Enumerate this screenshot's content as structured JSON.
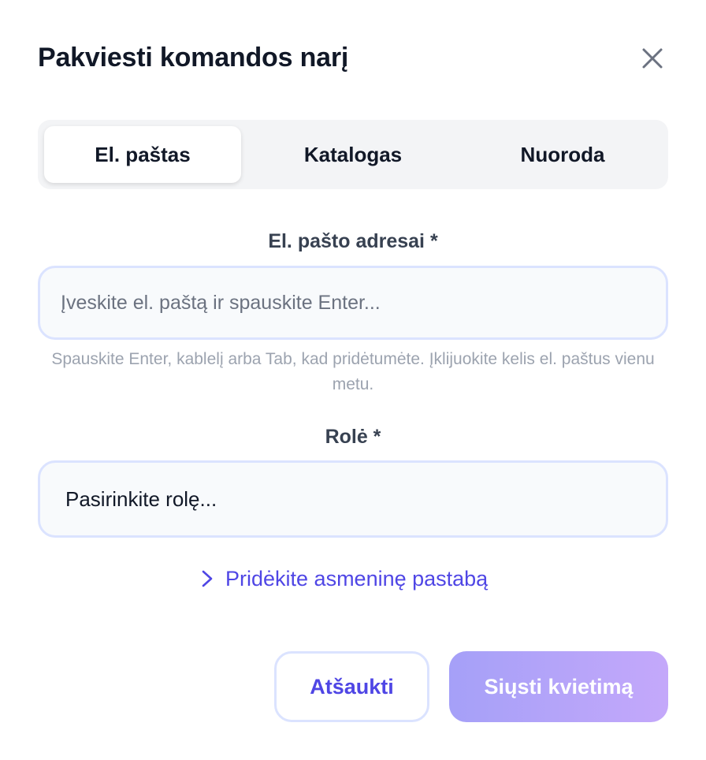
{
  "dialog": {
    "title": "Pakviesti komandos narį",
    "close_icon": "close-icon"
  },
  "tabs": [
    {
      "label": "El. paštas",
      "active": true
    },
    {
      "label": "Katalogas",
      "active": false
    },
    {
      "label": "Nuoroda",
      "active": false
    }
  ],
  "email": {
    "label": "El. pašto adresai *",
    "placeholder": "Įveskite el. paštą ir spauskite Enter...",
    "value": "",
    "helper": "Spauskite Enter, kablelį arba Tab, kad pridėtumėte. Įklijuokite kelis el. paštus vienu metu."
  },
  "role": {
    "label": "Rolė *",
    "selected": "Pasirinkite rolę..."
  },
  "note": {
    "label": "Pridėkite asmeninę pastabą",
    "icon": "chevron-right-icon"
  },
  "actions": {
    "cancel_label": "Atšaukti",
    "send_label": "Siųsti kvietimą"
  },
  "colors": {
    "accent": "#4f46e5",
    "input_border": "#dbe3ff",
    "send_gradient_start": "#a5a0f8",
    "send_gradient_end": "#c4a8fa"
  }
}
